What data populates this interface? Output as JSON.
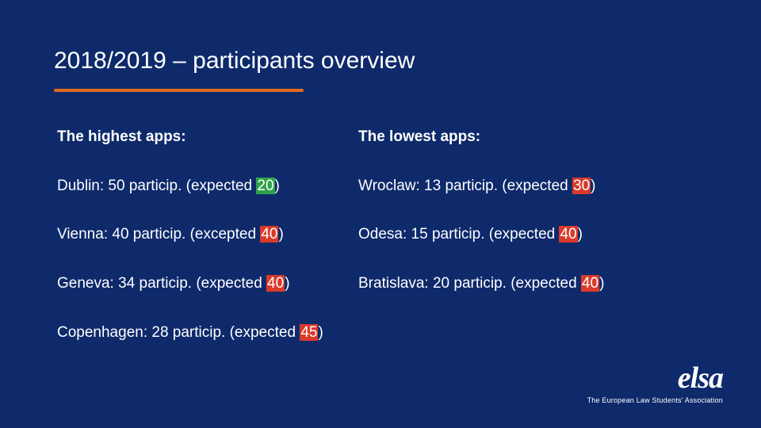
{
  "title": "2018/2019 – participants overview",
  "headings": {
    "highest": "The highest apps:",
    "lowest": "The lowest apps:"
  },
  "rows": [
    {
      "left": {
        "prefix": "Dublin: 50 particip. (expected ",
        "hl": "20",
        "hl_class": "hl-green",
        "suffix": ")"
      },
      "right": {
        "prefix": "Wroclaw: 13 particip. (expected ",
        "hl": "30",
        "hl_class": "hl-red",
        "suffix": ")"
      }
    },
    {
      "left": {
        "prefix": "Vienna: 40 particip. (excepted ",
        "hl": "40",
        "hl_class": "hl-red",
        "suffix": ")"
      },
      "right": {
        "prefix": "Odesa: 15 particip. (expected ",
        "hl": "40",
        "hl_class": "hl-red",
        "suffix": ")"
      }
    },
    {
      "left": {
        "prefix": "Geneva: 34 particip. (expected ",
        "hl": "40",
        "hl_class": "hl-red",
        "suffix": ")"
      },
      "right": {
        "prefix": "Bratislava: 20 particip. (expected ",
        "hl": "40",
        "hl_class": "hl-red",
        "suffix": ")"
      }
    },
    {
      "left": {
        "prefix": "Copenhagen: 28 particip. (expected ",
        "hl": "45",
        "hl_class": "hl-red",
        "suffix": ")"
      },
      "right": null
    }
  ],
  "logo": {
    "main": "elsa",
    "sub": "The European Law Students' Association"
  }
}
